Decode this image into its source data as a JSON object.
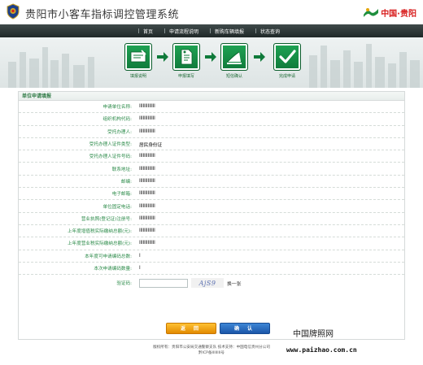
{
  "header": {
    "title": "贵阳市小客车指标调控管理系统",
    "brand": "中国·贵阳"
  },
  "nav": {
    "items": [
      "首页",
      "申请流程说明",
      "新购车辆填报",
      "状态查询"
    ]
  },
  "steps": [
    {
      "label": "填报说明"
    },
    {
      "label": "申报填写"
    },
    {
      "label": "短信确认"
    },
    {
      "label": "完成申请"
    }
  ],
  "form": {
    "heading": "单位申请填报",
    "rows": [
      {
        "label": "申请单位名称:",
        "value": "IIIIIIIIIIIII"
      },
      {
        "label": "组织机构代码:",
        "value": "IIIIIIIIIIIII"
      },
      {
        "label": "受托办理人:",
        "value": "IIIIIIIIIIIII"
      },
      {
        "label": "受托办理人证件类型:",
        "value": "居民身份证"
      },
      {
        "label": "受托办理人证件号码:",
        "value": "IIIIIIIIIIIII"
      },
      {
        "label": "联系地址:",
        "value": "IIIIIIIIIIIII"
      },
      {
        "label": "邮编:",
        "value": "IIIIIIIIIIIII"
      },
      {
        "label": "电子邮箱:",
        "value": "IIIIIIIIIIIII"
      },
      {
        "label": "单位固定电话:",
        "value": "IIIIIIIIIIIII"
      },
      {
        "label": "营业执照(登记证)注册号:",
        "value": "IIIIIIIIIIIII"
      },
      {
        "label": "上年度增值税实际缴纳总额(元):",
        "value": "IIIIIIIIIIIII"
      },
      {
        "label": "上年度营业税实际缴纳总额(元):",
        "value": "IIIIIIIIIIIII"
      },
      {
        "label": "本年度可申请编码总数:",
        "value": "I"
      },
      {
        "label": "本次申请编码数量:",
        "value": "I"
      }
    ],
    "captcha": {
      "label": "验证码:",
      "value": "",
      "image_text": "AjS9",
      "refresh": "换一张"
    },
    "back_button": "返 回",
    "confirm_button": "确 认"
  },
  "footer": {
    "line1": "版权所有：贵阳市公安局交通警察支队   技术支持：中国电信贵州分公司",
    "line2": "黔ICP备IIIIIIII号"
  },
  "watermark": {
    "site_name": "中国牌照网",
    "url": "www.paizhao.com.cn"
  },
  "colors": {
    "accent_green": "#2a8a48",
    "nav_dark": "#2b3535",
    "back_orange": "#f0a010",
    "confirm_blue": "#2a6cc0"
  }
}
